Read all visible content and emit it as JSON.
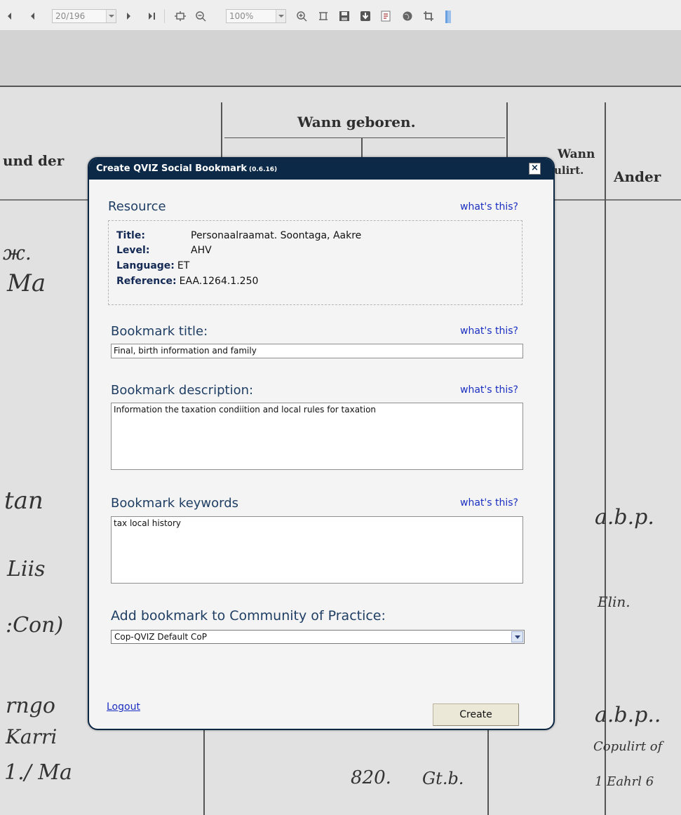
{
  "toolbar": {
    "page_value": "20/196",
    "zoom_value": "100%",
    "icons": [
      "first-page-icon",
      "prev-page-icon",
      "next-page-icon",
      "last-page-icon",
      "fit-page-icon",
      "zoom-out-icon",
      "zoom-in-icon",
      "fit-width-icon",
      "save-icon",
      "download-icon",
      "pdf-icon",
      "globe-icon",
      "crop-icon",
      "bookmark-icon"
    ]
  },
  "document": {
    "header_wann_geboren": "Wann geboren.",
    "header_und_der": "und der",
    "header_wann": "Wann",
    "header_ulirt": "ulirt.",
    "header_ander": "Ander"
  },
  "dialog": {
    "title": "Create QVIZ Social Bookmark",
    "version": "(0.6.16)",
    "close_label": "×",
    "resource": {
      "heading": "Resource",
      "whats_this": "what's this?",
      "title_key": "Title:",
      "title_value": "Personaalraamat. Soontaga, Aakre",
      "level_key": "Level:",
      "level_value": "AHV",
      "language_key": "Language:",
      "language_value": "ET",
      "reference_key": "Reference:",
      "reference_value": "EAA.1264.1.250"
    },
    "bookmark_title": {
      "label": "Bookmark title:",
      "whats_this": "what's this?",
      "value": "Final, birth information and family"
    },
    "bookmark_description": {
      "label": "Bookmark description:",
      "whats_this": "what's this?",
      "value": "Information the taxation condiition and local rules for taxation"
    },
    "bookmark_keywords": {
      "label": "Bookmark keywords",
      "whats_this": "what's this?",
      "value": "tax local history"
    },
    "community": {
      "label": "Add bookmark to Community of Practice:",
      "selected": "Cop-QVIZ Default CoP"
    },
    "logout_label": "Logout",
    "create_label": "Create"
  },
  "colors": {
    "titlebar": "#0c2a47",
    "link": "#1a2fc2",
    "heading": "#1f3e64",
    "dialog_bg": "#f4f4f4"
  }
}
